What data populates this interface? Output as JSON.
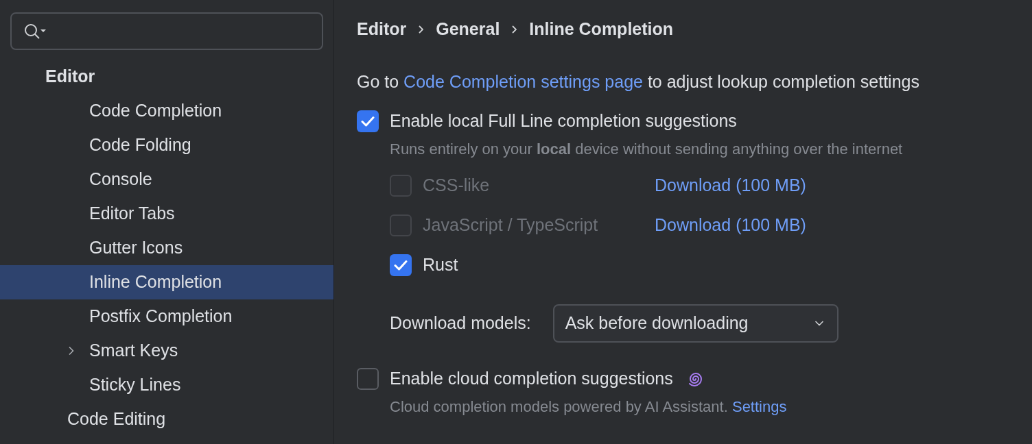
{
  "sidebar": {
    "items": [
      {
        "label": "Editor",
        "expanded": true,
        "selected": false,
        "children": [
          {
            "children": [
              {
                "label": "Code Completion",
                "selected": false
              },
              {
                "label": "Code Folding",
                "selected": false
              },
              {
                "label": "Console",
                "selected": false
              },
              {
                "label": "Editor Tabs",
                "selected": false
              },
              {
                "label": "Gutter Icons",
                "selected": false
              },
              {
                "label": "Inline Completion",
                "selected": true
              },
              {
                "label": "Postfix Completion",
                "selected": false
              },
              {
                "label": "Smart Keys",
                "selected": false,
                "expanded": false
              },
              {
                "label": "Sticky Lines",
                "selected": false
              }
            ]
          },
          {
            "label": "Code Editing",
            "selected": false
          }
        ]
      }
    ]
  },
  "breadcrumb": [
    "Editor",
    "General",
    "Inline Completion"
  ],
  "hint": {
    "before": "Go to",
    "link": "Code Completion settings page",
    "after": "to adjust lookup completion settings"
  },
  "local": {
    "label": "Enable local Full Line completion suggestions",
    "checked": true,
    "description": "Runs entirely on your **local** device without sending anything over the internet",
    "languages": [
      {
        "label": "CSS-like",
        "checked": false,
        "disabled": true,
        "download": "Download (100 MB)"
      },
      {
        "label": "JavaScript / TypeScript",
        "checked": false,
        "disabled": true,
        "download": "Download (100 MB)"
      },
      {
        "label": "Rust",
        "checked": true,
        "disabled": false
      }
    ],
    "download_models": {
      "label": "Download models:",
      "value": "Ask before downloading"
    }
  },
  "cloud": {
    "label": "Enable cloud completion suggestions",
    "checked": false,
    "description": "Cloud completion models powered by AI Assistant.",
    "link": "Settings"
  }
}
